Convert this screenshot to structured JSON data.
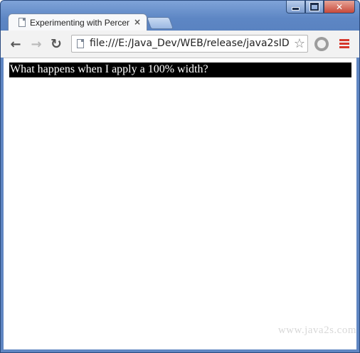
{
  "window": {
    "controls": {
      "minimize_label": "minimize",
      "maximize_label": "maximize",
      "close_glyph": "✕"
    }
  },
  "tab": {
    "title": "Experimenting with Percen",
    "close_glyph": "×",
    "icon": "page-icon"
  },
  "toolbar": {
    "back_glyph": "←",
    "forward_glyph": "→",
    "reload_glyph": "↻",
    "url": "file:///E:/Java_Dev/WEB/release/java2sID",
    "star_glyph": "☆",
    "extension_icon": "extension-icon",
    "menu_icon": "menu-icon",
    "menu_color": "#d6372c"
  },
  "page": {
    "block_text": "What happens when I apply a 100% width?",
    "block_background": "#000000",
    "block_text_color": "#ffffff",
    "watermark": "www.java2s.com"
  }
}
